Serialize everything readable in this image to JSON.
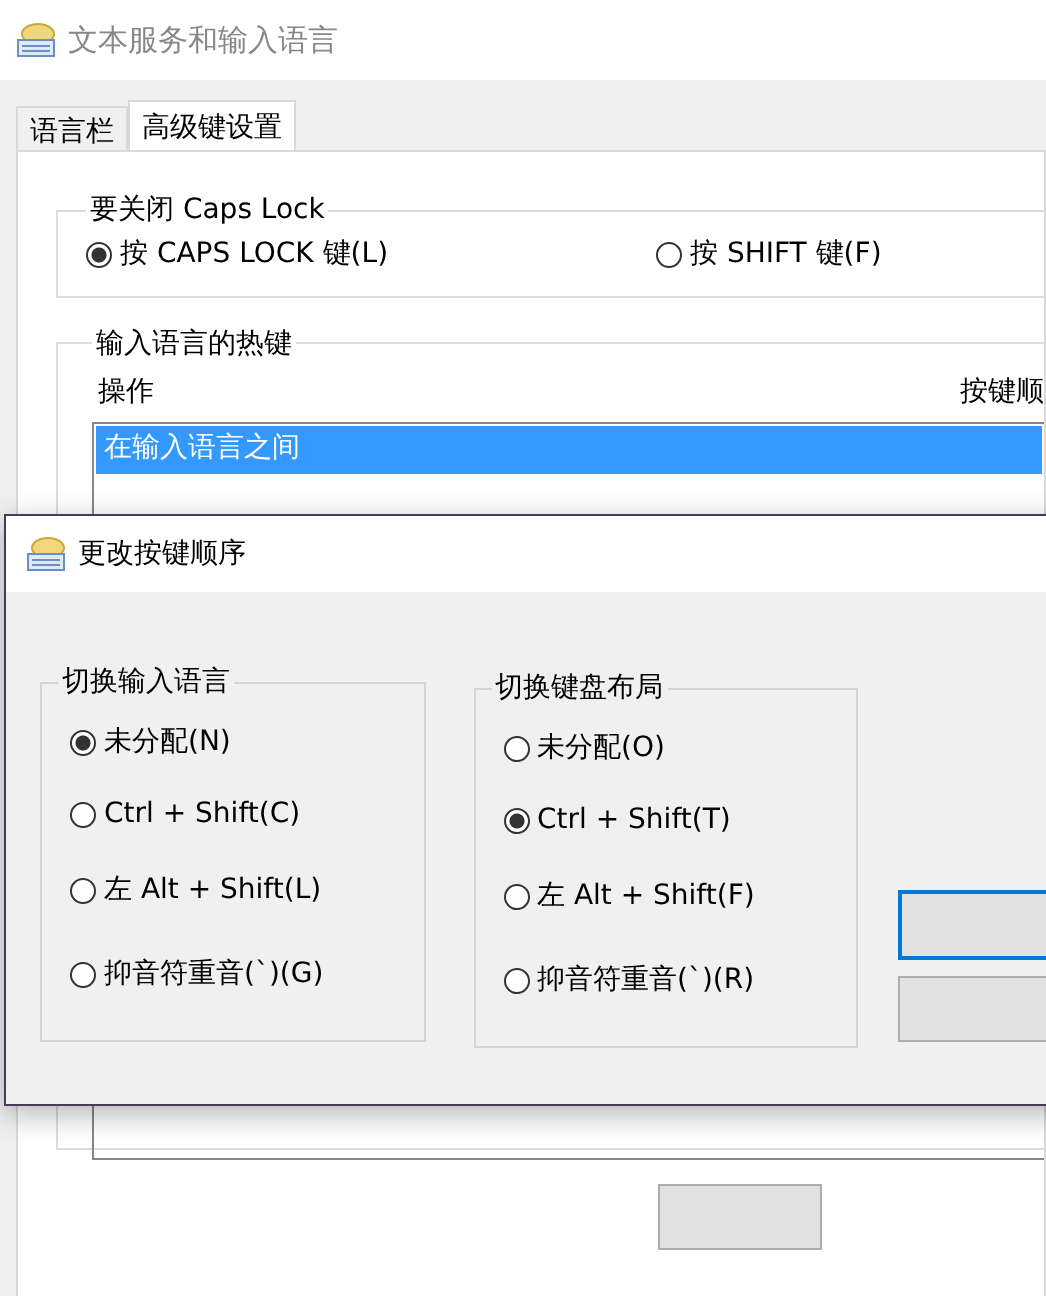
{
  "window": {
    "title": "文本服务和输入语言"
  },
  "tabs": [
    {
      "label": "语言栏",
      "selected": false
    },
    {
      "label": "高级键设置",
      "selected": true
    }
  ],
  "caps_lock_group": {
    "title": "要关闭 Caps Lock",
    "options": [
      {
        "label": "按 CAPS LOCK 键(L)",
        "selected": true
      },
      {
        "label": "按 SHIFT 键(F)",
        "selected": false
      }
    ]
  },
  "hotkeys_group": {
    "title": "输入语言的热键",
    "columns": [
      "操作",
      "按键顺"
    ],
    "rows": [
      {
        "action": "在输入语言之间",
        "selected": true
      }
    ]
  },
  "dialog": {
    "title": "更改按键顺序",
    "groups": [
      {
        "title": "切换输入语言",
        "options": [
          {
            "label": "未分配(N)",
            "selected": true
          },
          {
            "label": "Ctrl + Shift(C)",
            "selected": false
          },
          {
            "label": "左 Alt + Shift(L)",
            "selected": false
          },
          {
            "label": "抑音符重音(`)(G)",
            "selected": false
          }
        ]
      },
      {
        "title": "切换键盘布局",
        "options": [
          {
            "label": "未分配(O)",
            "selected": false
          },
          {
            "label": "Ctrl + Shift(T)",
            "selected": true
          },
          {
            "label": "左 Alt + Shift(F)",
            "selected": false
          },
          {
            "label": "抑音符重音(`)(R)",
            "selected": false
          }
        ]
      }
    ]
  }
}
